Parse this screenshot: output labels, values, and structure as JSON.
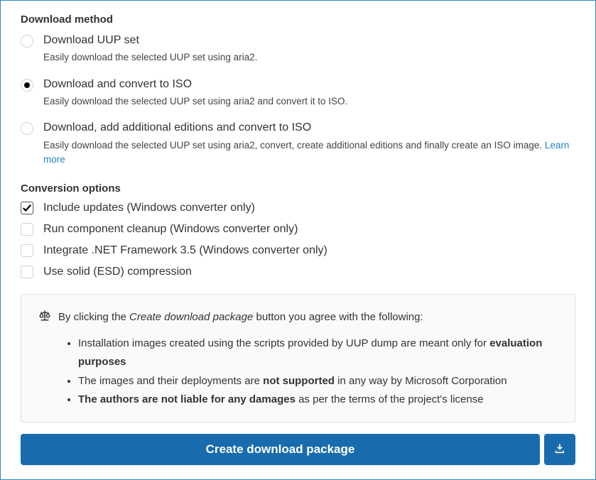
{
  "download_method": {
    "title": "Download method",
    "options": [
      {
        "label": "Download UUP set",
        "desc": "Easily download the selected UUP set using aria2.",
        "checked": false
      },
      {
        "label": "Download and convert to ISO",
        "desc": "Easily download the selected UUP set using aria2 and convert it to ISO.",
        "checked": true
      },
      {
        "label": "Download, add additional editions and convert to ISO",
        "desc": "Easily download the selected UUP set using aria2, convert, create additional editions and finally create an ISO image. ",
        "link": "Learn more",
        "checked": false
      }
    ]
  },
  "conversion_options": {
    "title": "Conversion options",
    "items": [
      {
        "label": "Include updates (Windows converter only)",
        "checked": true
      },
      {
        "label": "Run component cleanup (Windows converter only)",
        "checked": false
      },
      {
        "label": "Integrate .NET Framework 3.5 (Windows converter only)",
        "checked": false
      },
      {
        "label": "Use solid (ESD) compression",
        "checked": false
      }
    ]
  },
  "notice": {
    "intro_pre": "By clicking the ",
    "intro_em": "Create download package",
    "intro_post": " button you agree with the following:",
    "items": [
      {
        "pre": "Installation images created using the scripts provided by UUP dump are meant only for ",
        "bold": "evaluation purposes",
        "post": ""
      },
      {
        "pre": "The images and their deployments are ",
        "bold": "not supported",
        "post": " in any way by Microsoft Corporation"
      },
      {
        "pre": "",
        "bold": "The authors are not liable for any damages",
        "post": " as per the terms of the project's license"
      }
    ]
  },
  "button": {
    "label": "Create download package"
  }
}
